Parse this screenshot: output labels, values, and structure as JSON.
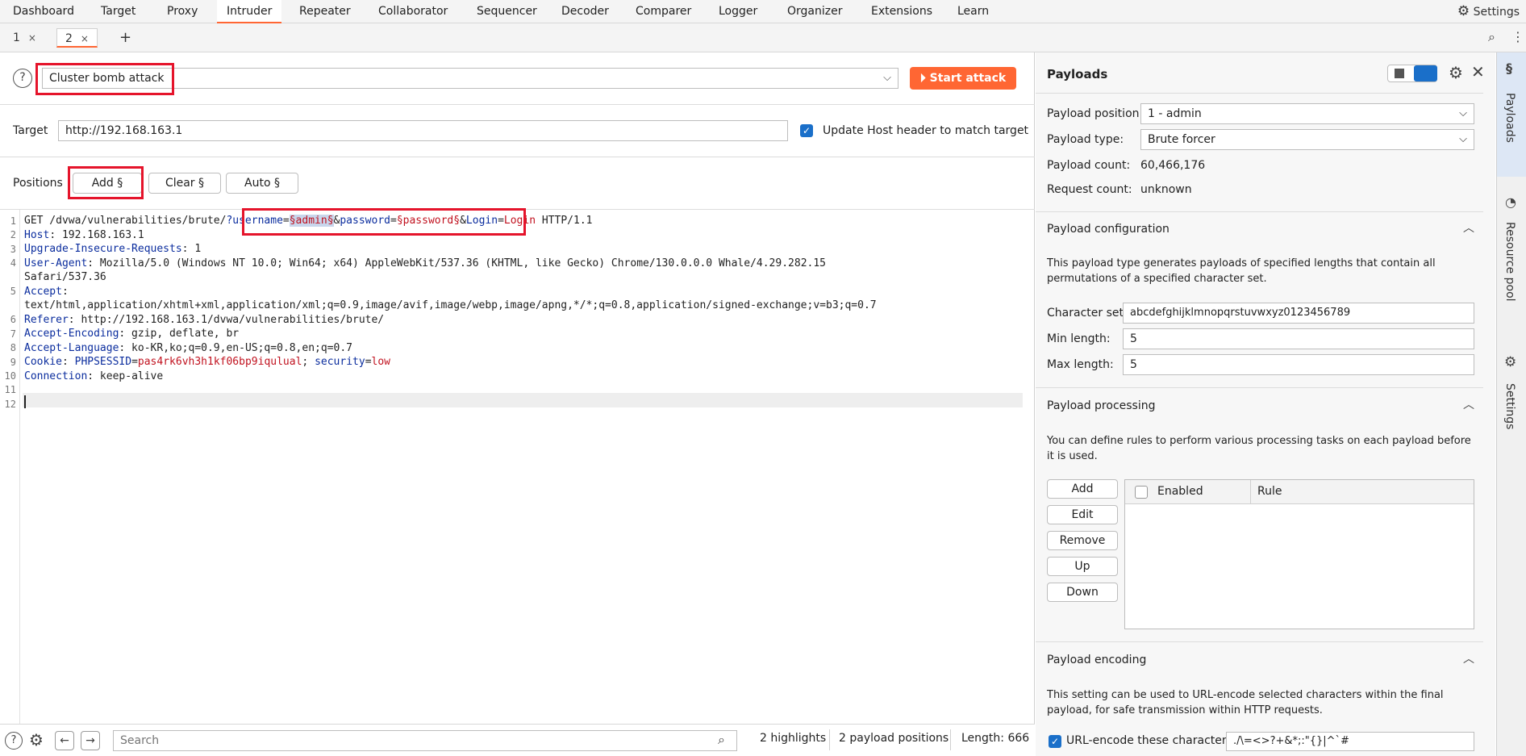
{
  "menu": {
    "items": [
      "Dashboard",
      "Target",
      "Proxy",
      "Intruder",
      "Repeater",
      "Collaborator",
      "Sequencer",
      "Decoder",
      "Comparer",
      "Logger",
      "Organizer",
      "Extensions",
      "Learn"
    ],
    "active": "Intruder",
    "settings_label": "Settings"
  },
  "tabs": {
    "items": [
      {
        "label": "1",
        "close": "×"
      },
      {
        "label": "2",
        "close": "×"
      }
    ],
    "add": "+"
  },
  "attack": {
    "type": "Cluster bomb attack",
    "start_label": "Start attack"
  },
  "target": {
    "label": "Target",
    "url": "http://192.168.163.1",
    "update_host_label": "Update Host header to match target",
    "update_host_checked": true
  },
  "positions": {
    "label": "Positions",
    "add_label": "Add §",
    "clear_label": "Clear §",
    "auto_label": "Auto §"
  },
  "request": {
    "line_numbers": [
      "1",
      "2",
      "3",
      "4",
      "",
      "5",
      "",
      "6",
      "7",
      "8",
      "9",
      "10",
      "11",
      "12"
    ],
    "l1_method": "GET /dvwa/vulnerabilities/brute/",
    "l1_q": "?",
    "l1_user_key": "username",
    "l1_eq": "=",
    "l1_user_val": "§admin§",
    "l1_amp1": "&",
    "l1_pass_key": "password",
    "l1_eq2": "=",
    "l1_pass_val": "§password§",
    "l1_amp2": "&",
    "l1_login_key": "Login",
    "l1_eq3": "=",
    "l1_login_val": "Login",
    "l1_proto": " HTTP/1.1",
    "h_host_k": "Host",
    "h_host_v": ": 192.168.163.1",
    "h_upg_k": "Upgrade-Insecure-Requests",
    "h_upg_v": ": 1",
    "h_ua_k": "User-Agent",
    "h_ua_v": ": Mozilla/5.0 (Windows NT 10.0; Win64; x64) AppleWebKit/537.36 (KHTML, like Gecko) Chrome/130.0.0.0 Whale/4.29.282.15",
    "h_ua_v2": "Safari/537.36",
    "h_acc_k": "Accept",
    "h_acc_v": ":",
    "h_acc_v2": "text/html,application/xhtml+xml,application/xml;q=0.9,image/avif,image/webp,image/apng,*/*;q=0.8,application/signed-exchange;v=b3;q=0.7",
    "h_ref_k": "Referer",
    "h_ref_v": ": http://192.168.163.1/dvwa/vulnerabilities/brute/",
    "h_enc_k": "Accept-Encoding",
    "h_enc_v": ": gzip, deflate, br",
    "h_lang_k": "Accept-Language",
    "h_lang_v": ": ko-KR,ko;q=0.9,en-US;q=0.8,en;q=0.7",
    "h_cookie_k": "Cookie",
    "h_cookie_sep": ": ",
    "h_cookie_sid_k": "PHPSESSID",
    "h_cookie_eq": "=",
    "h_cookie_sid_v": "pas4rk6vh3h1kf06bp9iqulual",
    "h_cookie_semi": "; ",
    "h_cookie_sec_k": "security",
    "h_cookie_eq2": "=",
    "h_cookie_sec_v": "low",
    "h_conn_k": "Connection",
    "h_conn_v": ": keep-alive"
  },
  "bottom": {
    "search_placeholder": "Search",
    "highlights": "2 highlights",
    "payload_positions": "2 payload positions",
    "length": "Length: 666"
  },
  "payloads": {
    "title": "Payloads",
    "position_label": "Payload position:",
    "position_value": "1 - admin",
    "type_label": "Payload type:",
    "type_value": "Brute forcer",
    "count_label": "Payload count:",
    "count_value": "60,466,176",
    "request_label": "Request count:",
    "request_value": "unknown",
    "config": {
      "title": "Payload configuration",
      "desc": "This payload type generates payloads of specified lengths that contain all permutations of a specified character set.",
      "charset_label": "Character set:",
      "charset_value": "abcdefghijklmnopqrstuvwxyz0123456789",
      "min_label": "Min length:",
      "min_value": "5",
      "max_label": "Max length:",
      "max_value": "5"
    },
    "processing": {
      "title": "Payload processing",
      "desc": "You can define rules to perform various processing tasks on each payload before it is used.",
      "buttons": [
        "Add",
        "Edit",
        "Remove",
        "Up",
        "Down"
      ],
      "col_enabled": "Enabled",
      "col_rule": "Rule"
    },
    "encoding": {
      "title": "Payload encoding",
      "desc": "This setting can be used to URL-encode selected characters within the final payload, for safe transmission within HTTP requests.",
      "url_encode_label": "URL-encode these characters:",
      "url_encode_value": "./\\=<>?+&*;:\"{}|^`#"
    }
  },
  "rail": {
    "payloads": "Payloads",
    "resource_pool": "Resource pool",
    "settings": "Settings"
  }
}
